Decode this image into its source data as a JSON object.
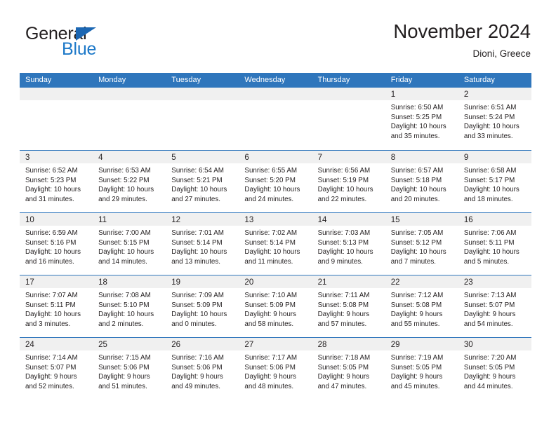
{
  "brand": {
    "name_part1": "General",
    "name_part2": "Blue",
    "triangle_icon": "blue-triangle-icon",
    "accent_color": "#1c78c8"
  },
  "header": {
    "title": "November 2024",
    "subtitle": "Dioni, Greece"
  },
  "colors": {
    "header_row": "#2f76bc",
    "day_band": "#f0f0f0",
    "text": "#231f20"
  },
  "weekdays": [
    "Sunday",
    "Monday",
    "Tuesday",
    "Wednesday",
    "Thursday",
    "Friday",
    "Saturday"
  ],
  "weeks": [
    [
      {
        "day": "",
        "sunrise": "",
        "sunset": "",
        "daylight_line1": "",
        "daylight_line2": ""
      },
      {
        "day": "",
        "sunrise": "",
        "sunset": "",
        "daylight_line1": "",
        "daylight_line2": ""
      },
      {
        "day": "",
        "sunrise": "",
        "sunset": "",
        "daylight_line1": "",
        "daylight_line2": ""
      },
      {
        "day": "",
        "sunrise": "",
        "sunset": "",
        "daylight_line1": "",
        "daylight_line2": ""
      },
      {
        "day": "",
        "sunrise": "",
        "sunset": "",
        "daylight_line1": "",
        "daylight_line2": ""
      },
      {
        "day": "1",
        "sunrise": "Sunrise: 6:50 AM",
        "sunset": "Sunset: 5:25 PM",
        "daylight_line1": "Daylight: 10 hours",
        "daylight_line2": "and 35 minutes."
      },
      {
        "day": "2",
        "sunrise": "Sunrise: 6:51 AM",
        "sunset": "Sunset: 5:24 PM",
        "daylight_line1": "Daylight: 10 hours",
        "daylight_line2": "and 33 minutes."
      }
    ],
    [
      {
        "day": "3",
        "sunrise": "Sunrise: 6:52 AM",
        "sunset": "Sunset: 5:23 PM",
        "daylight_line1": "Daylight: 10 hours",
        "daylight_line2": "and 31 minutes."
      },
      {
        "day": "4",
        "sunrise": "Sunrise: 6:53 AM",
        "sunset": "Sunset: 5:22 PM",
        "daylight_line1": "Daylight: 10 hours",
        "daylight_line2": "and 29 minutes."
      },
      {
        "day": "5",
        "sunrise": "Sunrise: 6:54 AM",
        "sunset": "Sunset: 5:21 PM",
        "daylight_line1": "Daylight: 10 hours",
        "daylight_line2": "and 27 minutes."
      },
      {
        "day": "6",
        "sunrise": "Sunrise: 6:55 AM",
        "sunset": "Sunset: 5:20 PM",
        "daylight_line1": "Daylight: 10 hours",
        "daylight_line2": "and 24 minutes."
      },
      {
        "day": "7",
        "sunrise": "Sunrise: 6:56 AM",
        "sunset": "Sunset: 5:19 PM",
        "daylight_line1": "Daylight: 10 hours",
        "daylight_line2": "and 22 minutes."
      },
      {
        "day": "8",
        "sunrise": "Sunrise: 6:57 AM",
        "sunset": "Sunset: 5:18 PM",
        "daylight_line1": "Daylight: 10 hours",
        "daylight_line2": "and 20 minutes."
      },
      {
        "day": "9",
        "sunrise": "Sunrise: 6:58 AM",
        "sunset": "Sunset: 5:17 PM",
        "daylight_line1": "Daylight: 10 hours",
        "daylight_line2": "and 18 minutes."
      }
    ],
    [
      {
        "day": "10",
        "sunrise": "Sunrise: 6:59 AM",
        "sunset": "Sunset: 5:16 PM",
        "daylight_line1": "Daylight: 10 hours",
        "daylight_line2": "and 16 minutes."
      },
      {
        "day": "11",
        "sunrise": "Sunrise: 7:00 AM",
        "sunset": "Sunset: 5:15 PM",
        "daylight_line1": "Daylight: 10 hours",
        "daylight_line2": "and 14 minutes."
      },
      {
        "day": "12",
        "sunrise": "Sunrise: 7:01 AM",
        "sunset": "Sunset: 5:14 PM",
        "daylight_line1": "Daylight: 10 hours",
        "daylight_line2": "and 13 minutes."
      },
      {
        "day": "13",
        "sunrise": "Sunrise: 7:02 AM",
        "sunset": "Sunset: 5:14 PM",
        "daylight_line1": "Daylight: 10 hours",
        "daylight_line2": "and 11 minutes."
      },
      {
        "day": "14",
        "sunrise": "Sunrise: 7:03 AM",
        "sunset": "Sunset: 5:13 PM",
        "daylight_line1": "Daylight: 10 hours",
        "daylight_line2": "and 9 minutes."
      },
      {
        "day": "15",
        "sunrise": "Sunrise: 7:05 AM",
        "sunset": "Sunset: 5:12 PM",
        "daylight_line1": "Daylight: 10 hours",
        "daylight_line2": "and 7 minutes."
      },
      {
        "day": "16",
        "sunrise": "Sunrise: 7:06 AM",
        "sunset": "Sunset: 5:11 PM",
        "daylight_line1": "Daylight: 10 hours",
        "daylight_line2": "and 5 minutes."
      }
    ],
    [
      {
        "day": "17",
        "sunrise": "Sunrise: 7:07 AM",
        "sunset": "Sunset: 5:11 PM",
        "daylight_line1": "Daylight: 10 hours",
        "daylight_line2": "and 3 minutes."
      },
      {
        "day": "18",
        "sunrise": "Sunrise: 7:08 AM",
        "sunset": "Sunset: 5:10 PM",
        "daylight_line1": "Daylight: 10 hours",
        "daylight_line2": "and 2 minutes."
      },
      {
        "day": "19",
        "sunrise": "Sunrise: 7:09 AM",
        "sunset": "Sunset: 5:09 PM",
        "daylight_line1": "Daylight: 10 hours",
        "daylight_line2": "and 0 minutes."
      },
      {
        "day": "20",
        "sunrise": "Sunrise: 7:10 AM",
        "sunset": "Sunset: 5:09 PM",
        "daylight_line1": "Daylight: 9 hours",
        "daylight_line2": "and 58 minutes."
      },
      {
        "day": "21",
        "sunrise": "Sunrise: 7:11 AM",
        "sunset": "Sunset: 5:08 PM",
        "daylight_line1": "Daylight: 9 hours",
        "daylight_line2": "and 57 minutes."
      },
      {
        "day": "22",
        "sunrise": "Sunrise: 7:12 AM",
        "sunset": "Sunset: 5:08 PM",
        "daylight_line1": "Daylight: 9 hours",
        "daylight_line2": "and 55 minutes."
      },
      {
        "day": "23",
        "sunrise": "Sunrise: 7:13 AM",
        "sunset": "Sunset: 5:07 PM",
        "daylight_line1": "Daylight: 9 hours",
        "daylight_line2": "and 54 minutes."
      }
    ],
    [
      {
        "day": "24",
        "sunrise": "Sunrise: 7:14 AM",
        "sunset": "Sunset: 5:07 PM",
        "daylight_line1": "Daylight: 9 hours",
        "daylight_line2": "and 52 minutes."
      },
      {
        "day": "25",
        "sunrise": "Sunrise: 7:15 AM",
        "sunset": "Sunset: 5:06 PM",
        "daylight_line1": "Daylight: 9 hours",
        "daylight_line2": "and 51 minutes."
      },
      {
        "day": "26",
        "sunrise": "Sunrise: 7:16 AM",
        "sunset": "Sunset: 5:06 PM",
        "daylight_line1": "Daylight: 9 hours",
        "daylight_line2": "and 49 minutes."
      },
      {
        "day": "27",
        "sunrise": "Sunrise: 7:17 AM",
        "sunset": "Sunset: 5:06 PM",
        "daylight_line1": "Daylight: 9 hours",
        "daylight_line2": "and 48 minutes."
      },
      {
        "day": "28",
        "sunrise": "Sunrise: 7:18 AM",
        "sunset": "Sunset: 5:05 PM",
        "daylight_line1": "Daylight: 9 hours",
        "daylight_line2": "and 47 minutes."
      },
      {
        "day": "29",
        "sunrise": "Sunrise: 7:19 AM",
        "sunset": "Sunset: 5:05 PM",
        "daylight_line1": "Daylight: 9 hours",
        "daylight_line2": "and 45 minutes."
      },
      {
        "day": "30",
        "sunrise": "Sunrise: 7:20 AM",
        "sunset": "Sunset: 5:05 PM",
        "daylight_line1": "Daylight: 9 hours",
        "daylight_line2": "and 44 minutes."
      }
    ]
  ]
}
